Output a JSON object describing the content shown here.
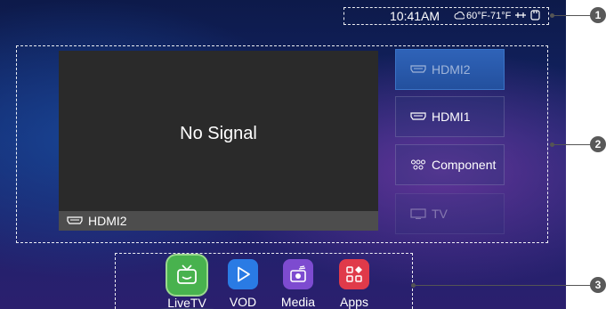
{
  "status_bar": {
    "time": "10:41AM",
    "weather": "60°F-71°F",
    "weather_icon": "weather-icon",
    "network_icon": "network-icon",
    "storage_icon": "storage-icon"
  },
  "preview": {
    "message": "No Signal",
    "current_source": "HDMI2",
    "source_icon": "hdmi-icon"
  },
  "sources": [
    {
      "label": "HDMI2",
      "icon": "hdmi-icon",
      "state": "selected"
    },
    {
      "label": "HDMI1",
      "icon": "hdmi-icon",
      "state": "normal"
    },
    {
      "label": "Component",
      "icon": "component-icon",
      "state": "normal"
    },
    {
      "label": "TV",
      "icon": "tv-icon",
      "state": "dim"
    }
  ],
  "apps": [
    {
      "label": "LiveTV",
      "icon": "livetv-icon",
      "color": "#48b24e",
      "focused": true
    },
    {
      "label": "VOD",
      "icon": "play-icon",
      "color": "#2a7be4",
      "focused": false
    },
    {
      "label": "Media",
      "icon": "media-icon",
      "color": "#7d4bd0",
      "focused": false
    },
    {
      "label": "Apps",
      "icon": "apps-icon",
      "color": "#e03a4a",
      "focused": false
    }
  ],
  "callouts": [
    "1",
    "2",
    "3"
  ]
}
